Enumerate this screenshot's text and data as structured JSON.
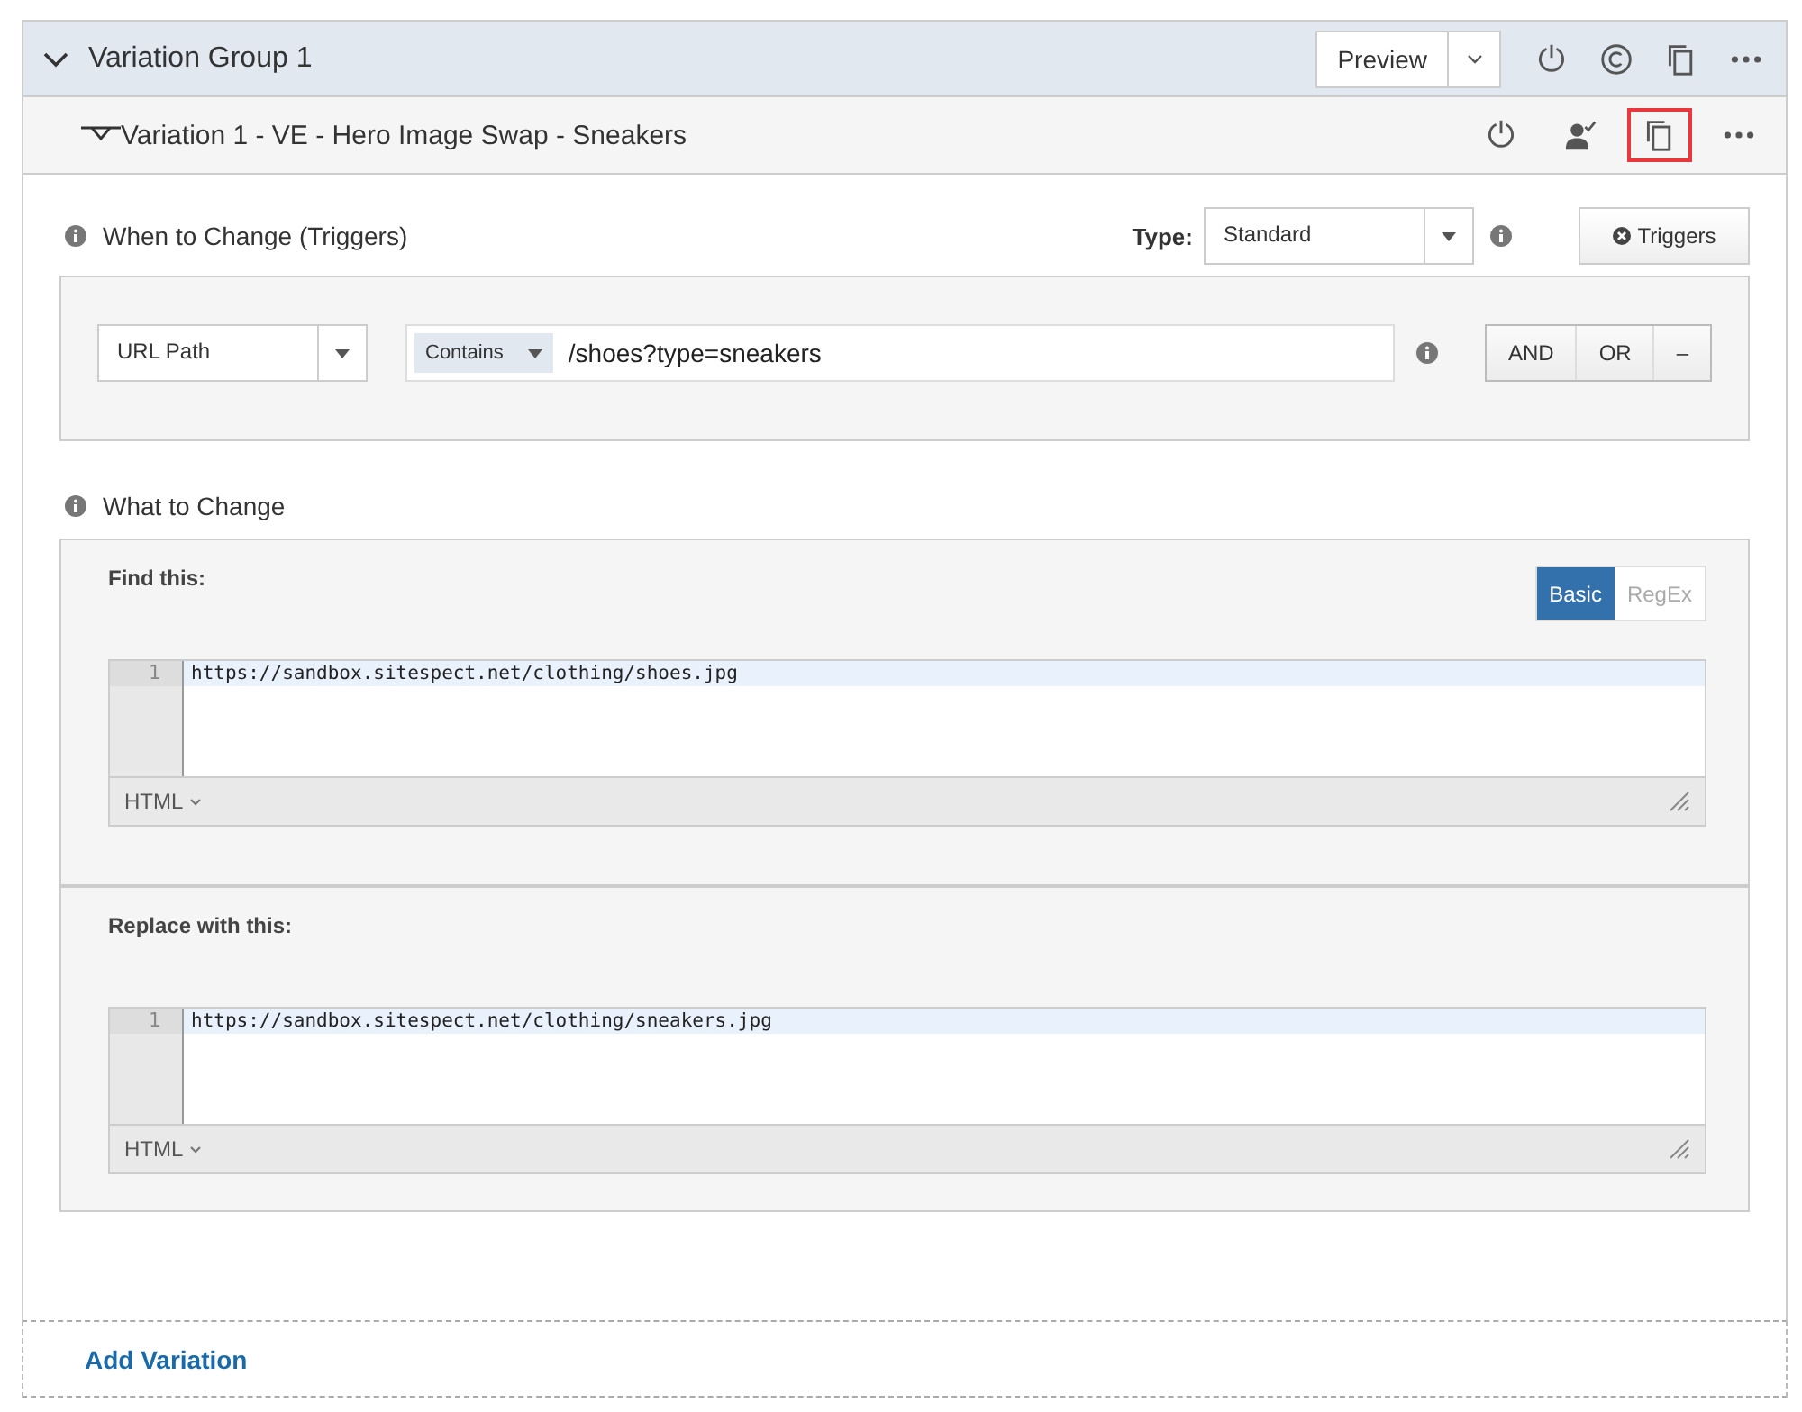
{
  "group": {
    "title": "Variation Group 1",
    "expanded": true,
    "preview_button": "Preview",
    "actions": [
      {
        "kind": "power"
      },
      {
        "kind": "copyright"
      },
      {
        "kind": "copy"
      },
      {
        "kind": "more"
      }
    ]
  },
  "variation": {
    "title": "Variation 1 - VE - Hero Image Swap - Sneakers",
    "actions": [
      {
        "kind": "power",
        "highlighted": false
      },
      {
        "kind": "person-check",
        "highlighted": false
      },
      {
        "kind": "copy",
        "highlighted": true
      },
      {
        "kind": "more",
        "highlighted": false
      }
    ]
  },
  "triggers": {
    "heading": "When to Change (Triggers)",
    "type_label": "Type:",
    "type_value": "Standard",
    "triggers_button": "Triggers",
    "conditions": [
      {
        "field": "URL Path",
        "operator": "Contains",
        "value": "/shoes?type=sneakers",
        "connectors": [
          "AND",
          "OR",
          "–"
        ]
      }
    ]
  },
  "changes": {
    "heading": "What to Change",
    "editors": [
      {
        "label": "Find this:",
        "modes": [
          {
            "label": "Basic",
            "selected": true
          },
          {
            "label": "RegEx",
            "selected": false
          }
        ],
        "lines": [
          {
            "number": "1",
            "text": "https://sandbox.sitespect.net/clothing/shoes.jpg"
          }
        ],
        "language": "HTML"
      },
      {
        "label": "Replace with this:",
        "lines": [
          {
            "number": "1",
            "text": "https://sandbox.sitespect.net/clothing/sneakers.jpg"
          }
        ],
        "language": "HTML"
      }
    ]
  },
  "add_variation": "Add Variation"
}
